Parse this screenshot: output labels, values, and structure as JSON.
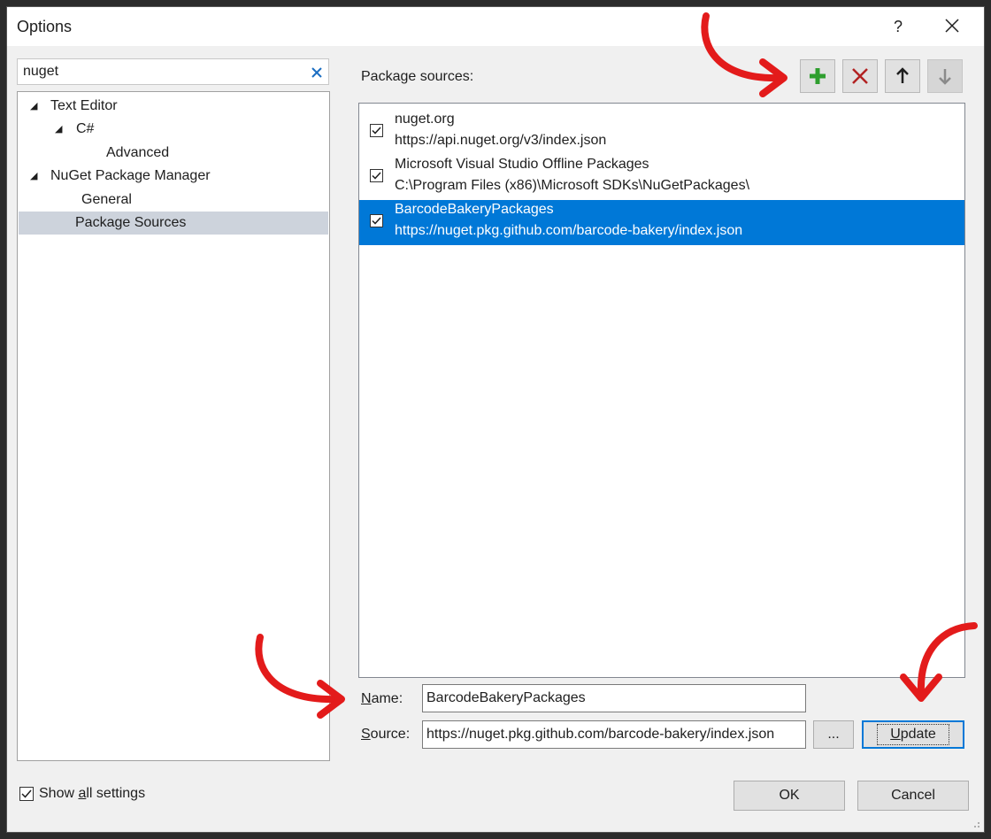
{
  "window": {
    "title": "Options",
    "help_label": "?",
    "close_label": "✕"
  },
  "search": {
    "value": "nuget",
    "clear_icon": "×"
  },
  "tree": {
    "items": [
      {
        "label": "Text Editor"
      },
      {
        "label": "C#"
      },
      {
        "label": "Advanced"
      },
      {
        "label": "NuGet Package Manager"
      },
      {
        "label": "General"
      },
      {
        "label": "Package Sources"
      }
    ]
  },
  "main": {
    "sources_label": "Package sources:",
    "toolbar": {
      "add_icon": "plus-icon",
      "remove_icon": "x-icon",
      "up_icon": "arrow-up-icon",
      "down_icon": "arrow-down-icon"
    },
    "sources": [
      {
        "name": "nuget.org",
        "url": "https://api.nuget.org/v3/index.json",
        "checked": true
      },
      {
        "name": "Microsoft Visual Studio Offline Packages",
        "url": "C:\\Program Files (x86)\\Microsoft SDKs\\NuGetPackages\\",
        "checked": true
      },
      {
        "name": "BarcodeBakeryPackages",
        "url": "https://nuget.pkg.github.com/barcode-bakery/index.json",
        "checked": true
      }
    ],
    "name_label_first": "N",
    "name_label_rest": "ame:",
    "name_value": "BarcodeBakeryPackages",
    "source_label_first": "S",
    "source_label_rest": "ource:",
    "source_value": "https://nuget.pkg.github.com/barcode-bakery/index.json",
    "browse_label": "...",
    "update_label_first": "U",
    "update_label_rest": "pdate"
  },
  "footer": {
    "show_all_pre": "Show ",
    "show_all_key": "a",
    "show_all_post": "ll settings",
    "ok_label": "OK",
    "cancel_label": "Cancel"
  },
  "colors": {
    "accent": "#0078d7",
    "annotation_arrow": "#e31b1b",
    "add_green": "#2e9e2e",
    "remove_red": "#b22222"
  }
}
